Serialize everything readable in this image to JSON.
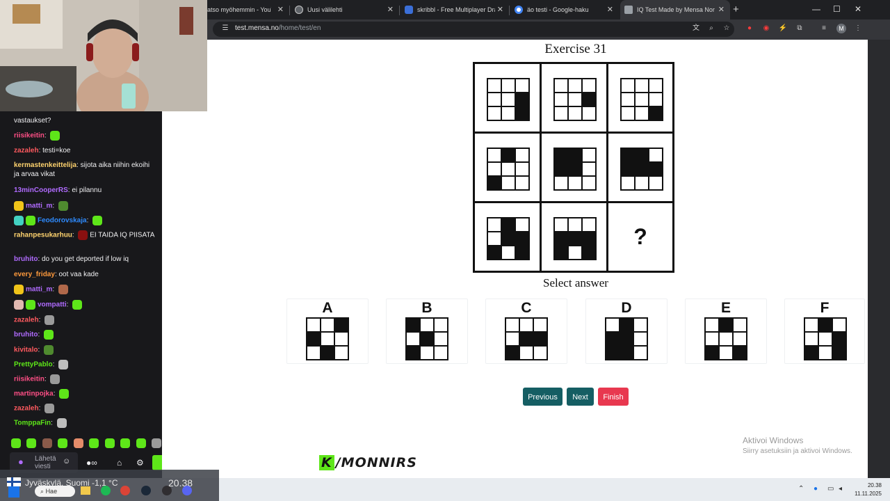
{
  "browser": {
    "tabs": [
      {
        "title": "atso myöhemmin - YouTube",
        "active": false
      },
      {
        "title": "Uusi välilehti",
        "active": false
      },
      {
        "title": "skribbl - Free Multiplayer Drawing",
        "active": false
      },
      {
        "title": "äo testi - Google-haku",
        "active": false
      },
      {
        "title": "IQ Test Made by Mensa Norway",
        "active": true
      }
    ],
    "url_host": "test.mensa.no",
    "url_path": "/home/test/en",
    "profile_initial": "M"
  },
  "test": {
    "title": "Exercise 31",
    "select_label": "Select answer",
    "question_mark": "?",
    "matrix": [
      [
        [
          0,
          0,
          0,
          0,
          0,
          1,
          0,
          0,
          1
        ],
        [
          0,
          0,
          0,
          0,
          0,
          1,
          0,
          0,
          0
        ],
        [
          0,
          0,
          0,
          0,
          0,
          0,
          0,
          0,
          1
        ]
      ],
      [
        [
          0,
          1,
          0,
          0,
          0,
          0,
          1,
          0,
          0
        ],
        [
          1,
          1,
          0,
          1,
          1,
          0,
          0,
          0,
          0
        ],
        [
          1,
          1,
          0,
          1,
          1,
          1,
          0,
          0,
          0
        ]
      ],
      [
        [
          0,
          1,
          0,
          0,
          1,
          1,
          1,
          0,
          1
        ],
        [
          0,
          0,
          0,
          1,
          1,
          1,
          1,
          0,
          1
        ],
        null
      ]
    ],
    "answers": [
      {
        "letter": "A",
        "cells": [
          0,
          0,
          1,
          1,
          0,
          0,
          0,
          1,
          0
        ]
      },
      {
        "letter": "B",
        "cells": [
          1,
          0,
          0,
          0,
          1,
          0,
          1,
          0,
          0
        ]
      },
      {
        "letter": "C",
        "cells": [
          0,
          0,
          0,
          0,
          1,
          1,
          1,
          0,
          0
        ]
      },
      {
        "letter": "D",
        "cells": [
          0,
          1,
          0,
          1,
          1,
          0,
          1,
          1,
          0
        ]
      },
      {
        "letter": "E",
        "cells": [
          0,
          1,
          0,
          0,
          0,
          0,
          1,
          0,
          1
        ]
      },
      {
        "letter": "F",
        "cells": [
          0,
          1,
          0,
          0,
          0,
          1,
          1,
          0,
          1
        ]
      }
    ],
    "buttons": {
      "previous": "Previous",
      "next": "Next",
      "finish": "Finish"
    },
    "colors": {
      "previous_next": "#155e63",
      "finish": "#e8384f"
    }
  },
  "windows_activation": {
    "line1": "Aktivoi Windows",
    "line2": "Siirry asetuksiin ja aktivoi Windows."
  },
  "chat": {
    "messages": [
      {
        "user": "",
        "color": "#efeff1",
        "text": "vastaukset?"
      },
      {
        "user": "riisikeitin",
        "color": "#ff4f86",
        "text": "",
        "emote": "#5ee619"
      },
      {
        "user": "zazaleh",
        "color": "#ff5a5f",
        "text": "testi=koe"
      },
      {
        "user": "kermastenkeittelija",
        "color": "#ffd36e",
        "text": "sijota aika niihin ekoihi ja arvaa vikat"
      },
      {
        "user": "13minCooperRS",
        "color": "#b06bff",
        "text": "ei pilannu"
      },
      {
        "user": "matti_m",
        "color": "#b06bff",
        "text": "",
        "emote": "#4f8a2f"
      },
      {
        "user": "Feodorovskaja",
        "color": "#2e8bff",
        "text": "",
        "emote": "#5ee619"
      },
      {
        "user": "rahanpesukarhuu",
        "color": "#ffd36e",
        "text": "EI TAIDA IQ PIISATA",
        "emote": "#8a1010"
      },
      {
        "user": "bruhito",
        "color": "#b06bff",
        "text": "do you get deported if low iq"
      },
      {
        "user": "every_friday",
        "color": "#ff9a3c",
        "text": "oot vaa kade"
      },
      {
        "user": "matti_m",
        "color": "#b06bff",
        "text": "",
        "emote": "#b0684a"
      },
      {
        "user": "vompatti",
        "color": "#b06bff",
        "text": "",
        "emote": "#5ee619"
      },
      {
        "user": "zazaleh",
        "color": "#ff5a5f",
        "text": "",
        "emote": "#9a9a9a"
      },
      {
        "user": "bruhito",
        "color": "#b06bff",
        "text": "",
        "emote": "#5ee619"
      },
      {
        "user": "kivitalo",
        "color": "#ff5a5f",
        "text": "",
        "emote": "#4f8a2f"
      },
      {
        "user": "PrettyPablo",
        "color": "#5ee619",
        "text": "",
        "emote": "#bdbdbd"
      },
      {
        "user": "riisikeitin",
        "color": "#ff4f86",
        "text": "",
        "emote": "#9a9a9a"
      },
      {
        "user": "martinpojka",
        "color": "#ff4f86",
        "text": "",
        "emote": "#5ee619"
      },
      {
        "user": "zazaleh",
        "color": "#ff5a5f",
        "text": "",
        "emote": "#9a9a9a"
      },
      {
        "user": "TomppaFin",
        "color": "#5ee619",
        "text": "",
        "emote": "#bdbdbd"
      }
    ],
    "input_placeholder": "Lähetä viesti"
  },
  "overlay_logo": {
    "k": "K",
    "rest": "/MONNIRS"
  },
  "taskbar": {
    "weather": "Jyväskylä, Suomi   -1,1 °C",
    "overlay_time": "20.38",
    "search": "Hae",
    "time": "20.38",
    "date": "11.11.2025"
  }
}
